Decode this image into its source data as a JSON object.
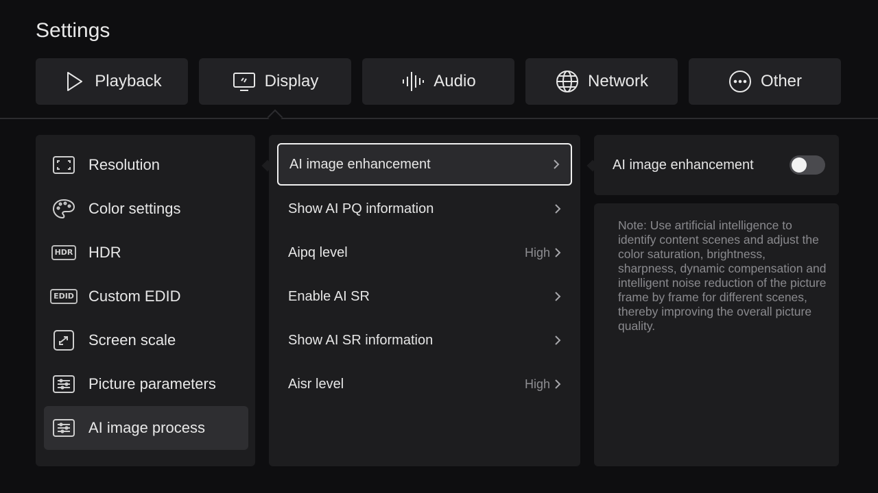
{
  "title": "Settings",
  "tabs": [
    {
      "label": "Playback",
      "icon": "play-icon"
    },
    {
      "label": "Display",
      "icon": "display-icon"
    },
    {
      "label": "Audio",
      "icon": "audio-wave-icon"
    },
    {
      "label": "Network",
      "icon": "globe-icon"
    },
    {
      "label": "Other",
      "icon": "more-icon"
    }
  ],
  "selected_tab": "Display",
  "sidebar": {
    "items": [
      {
        "label": "Resolution",
        "icon": "resolution-icon"
      },
      {
        "label": "Color settings",
        "icon": "palette-icon"
      },
      {
        "label": "HDR",
        "icon": "hdr-icon",
        "icon_text": "HDR"
      },
      {
        "label": "Custom EDID",
        "icon": "edid-icon",
        "icon_text": "EDID"
      },
      {
        "label": "Screen scale",
        "icon": "screen-scale-icon"
      },
      {
        "label": "Picture parameters",
        "icon": "sliders-icon"
      },
      {
        "label": "AI image process",
        "icon": "sliders-icon",
        "selected": true
      }
    ]
  },
  "menu": {
    "items": [
      {
        "label": "AI image enhancement",
        "value": "",
        "selected": true
      },
      {
        "label": "Show AI PQ information",
        "value": ""
      },
      {
        "label": "Aipq level",
        "value": "High"
      },
      {
        "label": "Enable AI SR",
        "value": ""
      },
      {
        "label": "Show AI SR information",
        "value": ""
      },
      {
        "label": "Aisr level",
        "value": "High"
      }
    ]
  },
  "detail": {
    "toggle_label": "AI image enhancement",
    "toggle_on": false,
    "note": "Note: Use artificial intelligence to identify content scenes and adjust the color saturation, brightness, sharpness, dynamic compensation and intelligent noise reduction of the picture frame by frame for different scenes, thereby improving the overall picture quality."
  }
}
